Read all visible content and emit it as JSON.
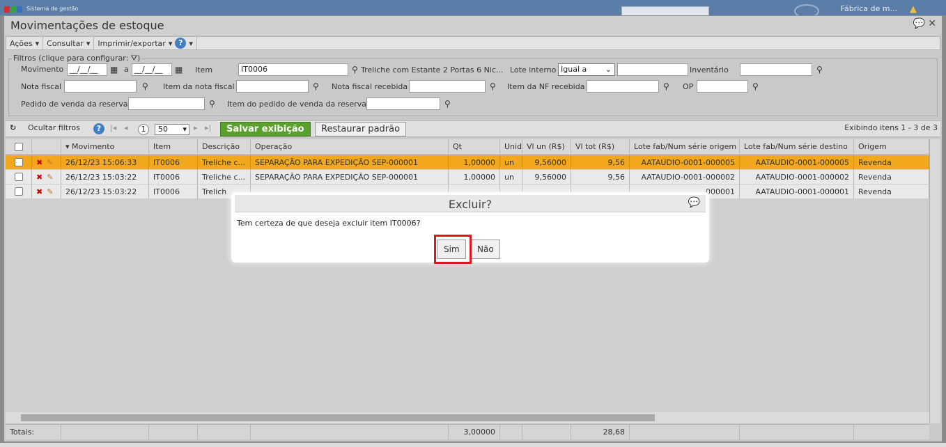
{
  "topbar": {
    "app_title": "Sistema de gestão",
    "company": "Fábrica de m...",
    "logo_colors": [
      "#d03030",
      "#3ca03c",
      "#3a6fc0"
    ]
  },
  "window": {
    "title": "Movimentações de estoque",
    "chat_icon": "speech-bubble-icon",
    "close_icon": "close-icon"
  },
  "menu": {
    "actions": "Ações",
    "consult": "Consultar",
    "print_export": "Imprimir/exportar",
    "help": "?"
  },
  "filters": {
    "legend": "Filtros (clique para configurar:",
    "legend_close": ")",
    "movimento_label": "Movimento",
    "date_placeholder": "__/__/__",
    "a_label": "a",
    "item_label": "Item",
    "item_value": "IT0006",
    "item_desc": "Treliche com Estante 2 Portas 6 Nic...",
    "lote_interno_label": "Lote interno",
    "lote_interno_option": "Igual a",
    "inventario_label": "Inventário",
    "nota_fiscal_label": "Nota fiscal",
    "item_nota_fiscal_label": "Item da nota fiscal",
    "nota_fiscal_recebida_label": "Nota fiscal recebida",
    "item_nf_recebida_label": "Item da NF recebida",
    "op_label": "OP",
    "pedido_venda_label": "Pedido de venda da reserva",
    "item_pedido_venda_label": "Item do pedido de venda da reserva"
  },
  "toolbar": {
    "hide_filters": "Ocultar filtros",
    "page": "1",
    "page_size": "50",
    "save_view": "Salvar exibição",
    "restore_default": "Restaurar padrão",
    "showing": "Exibindo itens 1 - 3 de 3"
  },
  "grid": {
    "columns": [
      "Movimento",
      "Item",
      "Descrição",
      "Operação",
      "Qt",
      "Unid",
      "Vl un (R$)",
      "Vl tot (R$)",
      "Lote fab/Num série origem",
      "Lote fab/Num série destino",
      "Origem"
    ],
    "rows": [
      {
        "movimento": "26/12/23 15:06:33",
        "item": "IT0006",
        "descricao": "Treliche c...",
        "operacao": "SEPARAÇÃO PARA EXPEDIÇÃO SEP-000001",
        "qt": "1,00000",
        "unid": "un",
        "vl_un": "9,56000",
        "vl_tot": "9,56",
        "lote_origem": "AATAUDIO-0001-000005",
        "lote_destino": "AATAUDIO-0001-000005",
        "origem": "Revenda"
      },
      {
        "movimento": "26/12/23 15:03:22",
        "item": "IT0006",
        "descricao": "Treliche c...",
        "operacao": "SEPARAÇÃO PARA EXPEDIÇÃO SEP-000001",
        "qt": "1,00000",
        "unid": "un",
        "vl_un": "9,56000",
        "vl_tot": "9,56",
        "lote_origem": "AATAUDIO-0001-000002",
        "lote_destino": "AATAUDIO-0001-000002",
        "origem": "Revenda"
      },
      {
        "movimento": "26/12/23 15:03:22",
        "item": "IT0006",
        "descricao": "Trelich",
        "operacao": "",
        "qt": "",
        "unid": "",
        "vl_un": "",
        "vl_tot": "",
        "lote_origem": "000001",
        "lote_destino": "AATAUDIO-0001-000001",
        "origem": "Revenda"
      }
    ],
    "selected_row_color": "#f2a81d"
  },
  "totals": {
    "label": "Totais:",
    "qt": "3,00000",
    "vl_tot": "28,68"
  },
  "dialog": {
    "title": "Excluir?",
    "message": "Tem certeza de que deseja excluir item IT0006?",
    "yes": "Sim",
    "no": "Não",
    "highlight_color": "#d71920"
  }
}
